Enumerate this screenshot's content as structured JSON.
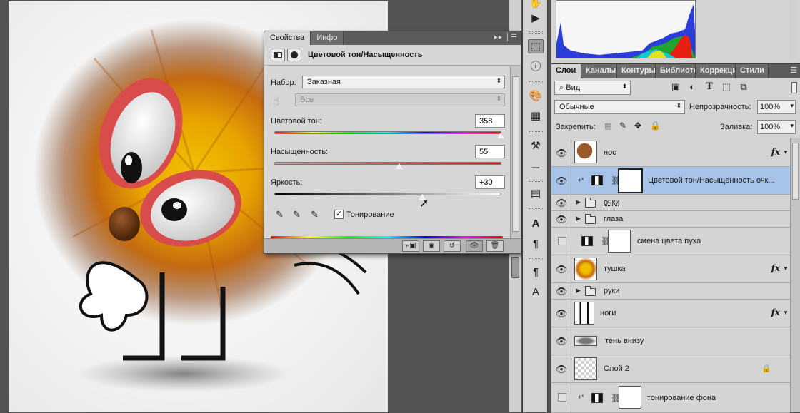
{
  "properties_panel": {
    "tabs": [
      "Свойства",
      "Инфо"
    ],
    "active_tab": "Свойства",
    "title": "Цветовой тон/Насыщенность",
    "preset_label": "Набор:",
    "preset_value": "Заказная",
    "channel_value": "Все",
    "hue": {
      "label": "Цветовой тон:",
      "value": "358",
      "fraction": 0.997
    },
    "saturation": {
      "label": "Насыщенность:",
      "value": "55",
      "fraction": 0.55
    },
    "lightness": {
      "label": "Яркость:",
      "value": "+30",
      "fraction": 0.65
    },
    "colorize_label": "Тонирование",
    "colorize_checked": true
  },
  "layers_panel": {
    "tabs": [
      "Слои",
      "Каналы",
      "Контуры",
      "Библиотеки",
      "Коррекция",
      "Стили"
    ],
    "active_tab": "Слои",
    "filter_kind": "Вид",
    "blend_mode": "Обычные",
    "opacity_label": "Непрозрачность:",
    "opacity_value": "100%",
    "lock_label": "Закрепить:",
    "fill_label": "Заливка:",
    "fill_value": "100%",
    "layers": [
      {
        "name": "нос",
        "type": "image",
        "visible": true,
        "fx": true
      },
      {
        "name": "Цветовой тон/Насыщенность очк...",
        "type": "adjustment",
        "visible": true,
        "clipped": true,
        "selected": true
      },
      {
        "name": "очки",
        "type": "group",
        "visible": true
      },
      {
        "name": "глаза",
        "type": "group",
        "visible": true
      },
      {
        "name": "смена цвета пуха",
        "type": "adjustment",
        "visible": false
      },
      {
        "name": "тушка",
        "type": "image",
        "visible": true,
        "fx": true
      },
      {
        "name": "руки",
        "type": "group",
        "visible": true
      },
      {
        "name": "ноги",
        "type": "image",
        "visible": true,
        "fx": true
      },
      {
        "name": "тень внизу",
        "type": "image",
        "visible": true
      },
      {
        "name": "Слой 2",
        "type": "image",
        "visible": true,
        "locked": true
      },
      {
        "name": "тонирование фона",
        "type": "adjustment",
        "visible": false,
        "clipped": true
      }
    ]
  },
  "colors": {
    "panel_bg": "#d4d4d4",
    "selection": "#a8c3e8",
    "workspace": "#535353"
  }
}
